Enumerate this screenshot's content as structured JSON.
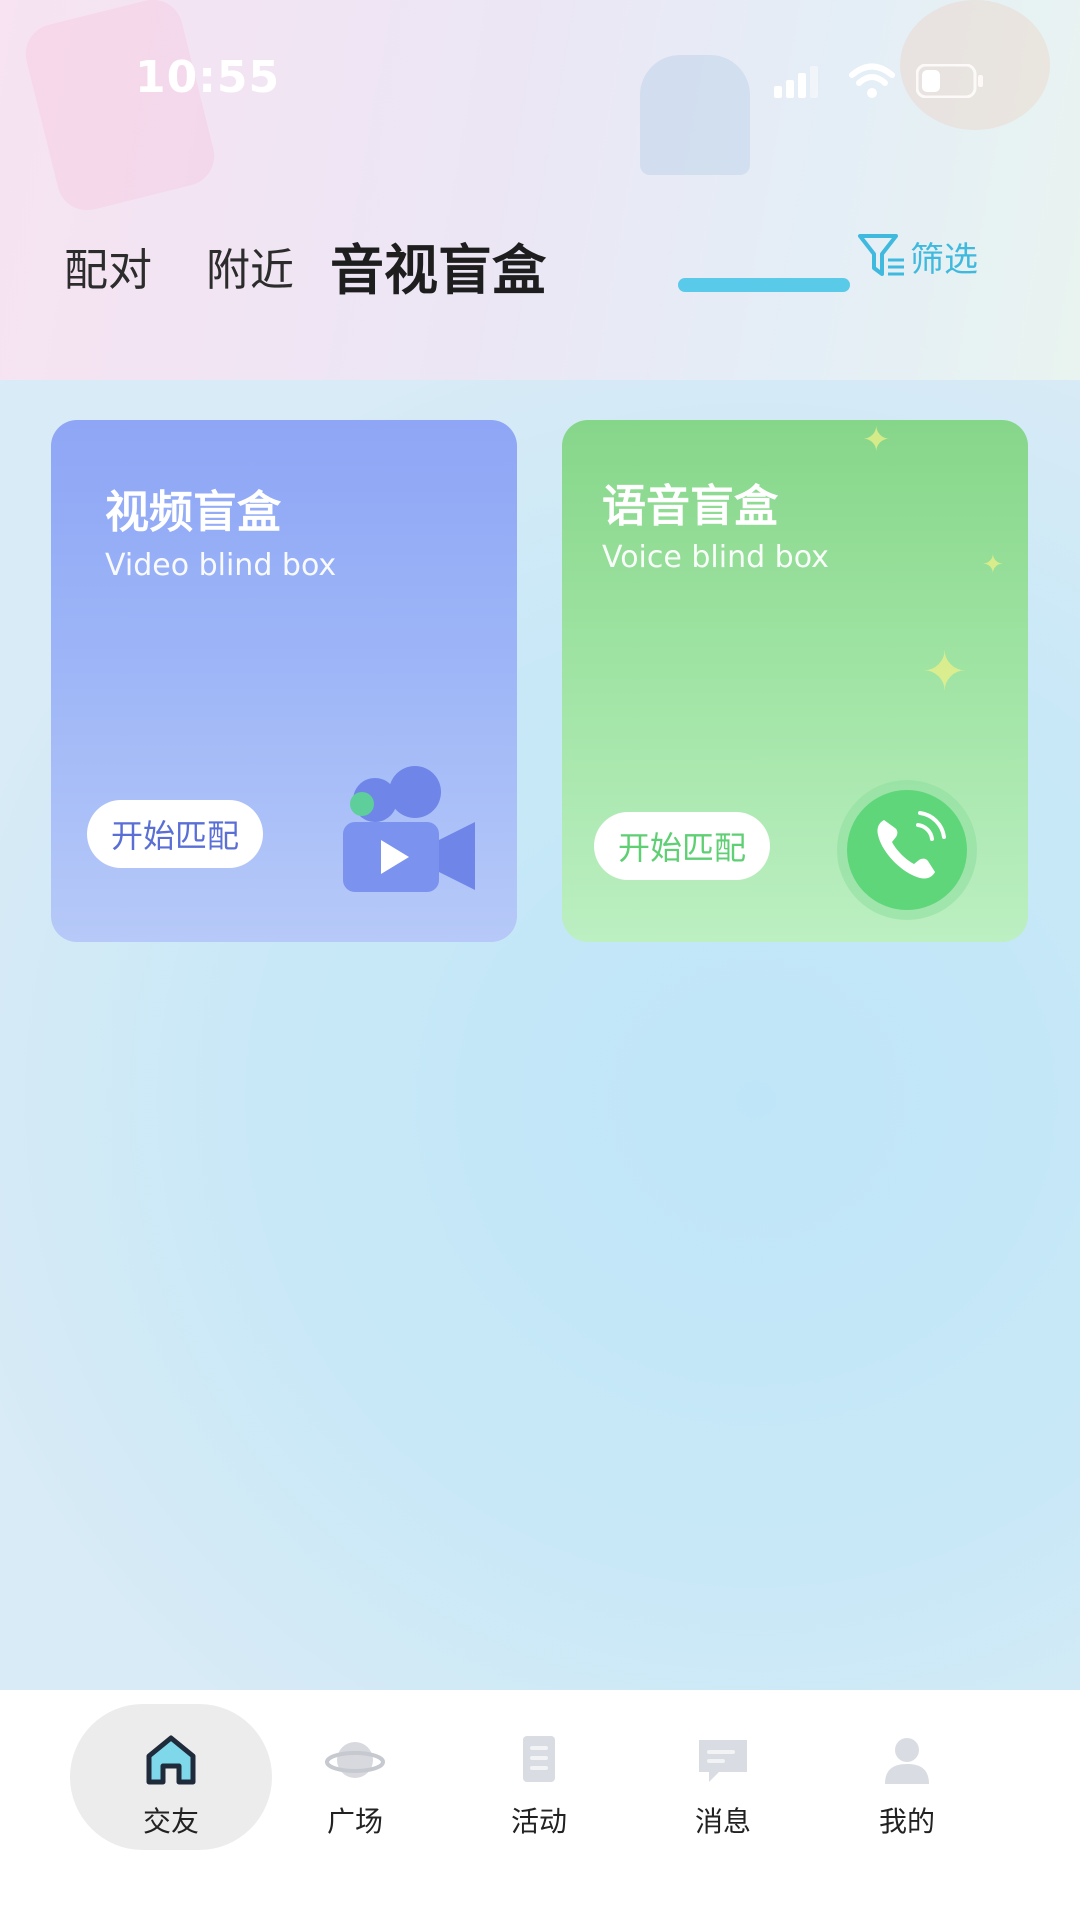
{
  "status_bar": {
    "time": "10:55"
  },
  "tabs": [
    {
      "label": "配对",
      "active": false
    },
    {
      "label": "附近",
      "active": false
    },
    {
      "label": "音视盲盒",
      "active": true
    }
  ],
  "filter": {
    "label": "筛选",
    "icon": "funnel-icon"
  },
  "cards": {
    "video": {
      "title": "视频盲盒",
      "subtitle": "Video blind box",
      "button": "开始匹配",
      "icon": "video-camera-icon",
      "color": "#8ea6f5"
    },
    "voice": {
      "title": "语音盲盒",
      "subtitle": "Voice blind box",
      "button": "开始匹配",
      "icon": "phone-call-icon",
      "color": "#86d68a"
    }
  },
  "bottom_nav": [
    {
      "label": "交友",
      "icon": "home-icon",
      "active": true
    },
    {
      "label": "广场",
      "icon": "planet-icon",
      "active": false
    },
    {
      "label": "活动",
      "icon": "document-icon",
      "active": false
    },
    {
      "label": "消息",
      "icon": "message-icon",
      "active": false
    },
    {
      "label": "我的",
      "icon": "user-icon",
      "active": false
    }
  ],
  "colors": {
    "accent": "#49c7e8",
    "filter": "#3fb9de"
  }
}
